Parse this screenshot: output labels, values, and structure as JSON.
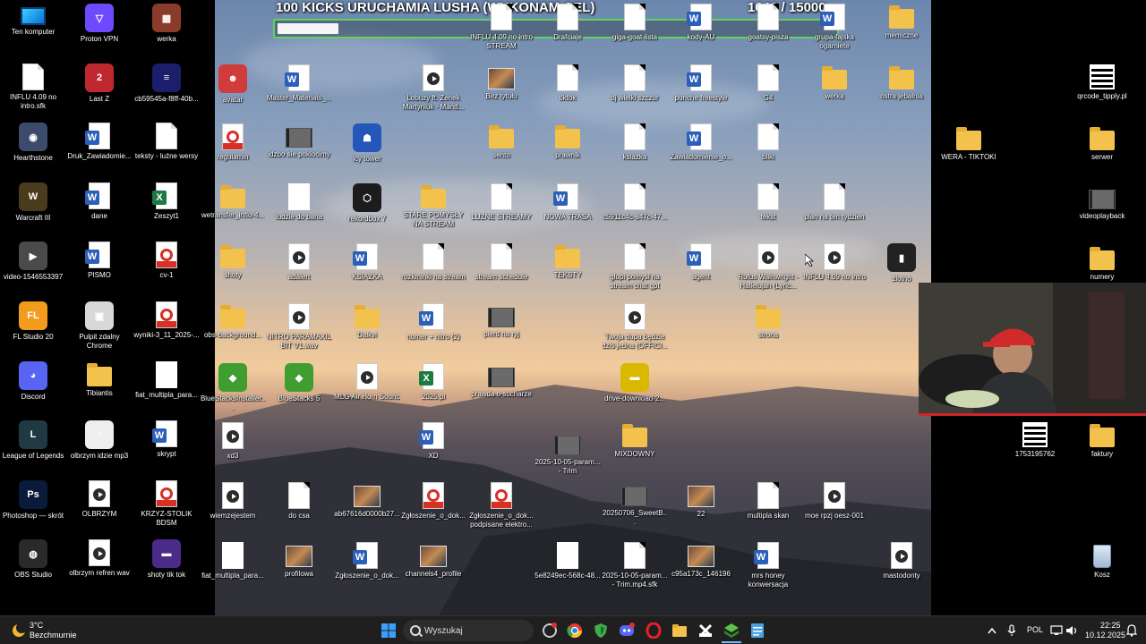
{
  "stream": {
    "title": "100 KICKS URUCHAMIA LUSHA (WYKONAM CEL)",
    "count": "1646",
    "goal": "/ 15000",
    "progress_fraction": 0.1097,
    "bar_color": "#5fd35f"
  },
  "desktop_left": [
    {
      "label": "Ten komputer",
      "type": "pc"
    },
    {
      "label": "Proton VPN",
      "type": "app",
      "color": "#6d4aff",
      "glyph": "▽"
    },
    {
      "label": "werka",
      "type": "app",
      "color": "#8b3b2a",
      "glyph": "▦"
    },
    {
      "label": "INFLU 4.09 no intro.sfk",
      "type": "doc"
    },
    {
      "label": "Last Z",
      "type": "app",
      "color": "#c0282f",
      "glyph": "2"
    },
    {
      "label": "cb59545a-f8ff-40b...",
      "type": "app",
      "color": "#1b1e6b",
      "glyph": "≡"
    },
    {
      "label": "Hearthstone",
      "type": "app",
      "color": "#3c4a6b",
      "glyph": "◉"
    },
    {
      "label": "Druk_Zawiadomie...",
      "type": "word"
    },
    {
      "label": "teksty - luźne wersy",
      "type": "doc"
    },
    {
      "label": "Warcraft III",
      "type": "app",
      "color": "#4a3b1f",
      "glyph": "W"
    },
    {
      "label": "dane",
      "type": "word"
    },
    {
      "label": "Zeszyt1",
      "type": "excel"
    },
    {
      "label": "video-1546553397",
      "type": "app",
      "color": "#4a4a4a",
      "glyph": "▶"
    },
    {
      "label": "PISMO",
      "type": "word"
    },
    {
      "label": "cv-1",
      "type": "pdf"
    },
    {
      "label": "FL Studio 20",
      "type": "app",
      "color": "#f29b1d",
      "glyph": "FL"
    },
    {
      "label": "Pulpit zdalny Chrome",
      "type": "app",
      "color": "#d8d8d8",
      "glyph": "▣"
    },
    {
      "label": "wyniki-3_11_2025-...",
      "type": "pdf"
    },
    {
      "label": "Discord",
      "type": "app",
      "color": "#5865f2",
      "glyph": "◕"
    },
    {
      "label": "Tibiantis",
      "type": "folder"
    },
    {
      "label": "fiat_multipla_para...",
      "type": "white"
    },
    {
      "label": "League of Legends",
      "type": "app",
      "color": "#1f3a43",
      "glyph": "L"
    },
    {
      "label": "olbrzym idzie mp3",
      "type": "app",
      "color": "#eeeeee",
      "glyph": "♪"
    },
    {
      "label": "skrypt",
      "type": "word"
    },
    {
      "label": "Photoshop — skrót",
      "type": "app",
      "color": "#0a1a3a",
      "glyph": "Ps"
    },
    {
      "label": "OLBRZYM",
      "type": "media"
    },
    {
      "label": "KRZYZ-STOLIK BDSM",
      "type": "pdf"
    },
    {
      "label": "OBS Studio",
      "type": "app",
      "color": "#2a2a2a",
      "glyph": "◍"
    },
    {
      "label": "olbrzym refren wav",
      "type": "media"
    },
    {
      "label": "shoty tik tok",
      "type": "app",
      "color": "#4b2b8a",
      "glyph": "▬"
    }
  ],
  "desktop_center": [
    {
      "label": "INFLU 4.09 no intro STREAM",
      "type": "doc"
    },
    {
      "label": "Drafciaje",
      "type": "doc"
    },
    {
      "label": "giga-goat-lista",
      "type": "doc"
    },
    {
      "label": "kody-AU",
      "type": "word"
    },
    {
      "label": "goatsy-pisza",
      "type": "doc"
    },
    {
      "label": "grupa-fajska ogarniete",
      "type": "word"
    },
    {
      "label": "memiczne",
      "type": "folder"
    },
    {
      "label": "avatar",
      "type": "app",
      "color": "#d23b3b",
      "glyph": "☻"
    },
    {
      "label": "Master_Materials_...",
      "type": "word"
    },
    {
      "label": "Lobuzy ft. Zenek Martyniuk - Mand...",
      "type": "media"
    },
    {
      "label": "Bez tytułu",
      "type": "image"
    },
    {
      "label": "tiktok",
      "type": "doc"
    },
    {
      "label": "dj wielki szczur",
      "type": "doc"
    },
    {
      "label": "punche freestyle",
      "type": "word"
    },
    {
      "label": "G4",
      "type": "doc"
    },
    {
      "label": "werka",
      "type": "folder"
    },
    {
      "label": "ostra jebalnia",
      "type": "folder"
    },
    {
      "label": "regulamin",
      "type": "pdf"
    },
    {
      "label": "idzbo sie poklocimy",
      "type": "video"
    },
    {
      "label": "icy tower",
      "type": "app",
      "color": "#2457b8",
      "glyph": "☗"
    },
    {
      "label": "sento",
      "type": "folder"
    },
    {
      "label": "prawnik",
      "type": "folder"
    },
    {
      "label": "ksiazka",
      "type": "doc"
    },
    {
      "label": "Zawiadomienie_o...",
      "type": "word"
    },
    {
      "label": "bilki",
      "type": "doc"
    },
    {
      "label": "wetransfer_influ-4...",
      "type": "folder"
    },
    {
      "label": "ludzie do bana",
      "type": "white"
    },
    {
      "label": "rekordbox 7",
      "type": "app",
      "color": "#1c1c1c",
      "glyph": "⬡"
    },
    {
      "label": "STARE POMYSŁY NA STREAM",
      "type": "folder"
    },
    {
      "label": "LUŹNE STREAMY",
      "type": "doc"
    },
    {
      "label": "NOWA TRASA",
      "type": "word"
    },
    {
      "label": "c5911c4c-a47c-47...",
      "type": "doc"
    },
    {
      "label": "tekst",
      "type": "doc"
    },
    {
      "label": "plan na ten tydzien",
      "type": "doc"
    },
    {
      "label": "shoty",
      "type": "folder"
    },
    {
      "label": "adalert",
      "type": "media"
    },
    {
      "label": "KSIAZKA",
      "type": "word"
    },
    {
      "label": "rozkminki na stream",
      "type": "doc"
    },
    {
      "label": "stream schedule",
      "type": "doc"
    },
    {
      "label": "TEKSTY",
      "type": "folder"
    },
    {
      "label": "glupi pomysl na stream chat gpt",
      "type": "doc"
    },
    {
      "label": "agent",
      "type": "word"
    },
    {
      "label": "Rufus Wainwright - Hallelujah (Lyric...",
      "type": "media"
    },
    {
      "label": "INFLU 4.09 no intro",
      "type": "media"
    },
    {
      "label": "zlotno",
      "type": "app",
      "color": "#222",
      "glyph": "▮"
    },
    {
      "label": "obs-background...",
      "type": "folder"
    },
    {
      "label": "NITRO PARAMAXIL BIT V1.wav",
      "type": "media"
    },
    {
      "label": "Dalkvi",
      "type": "folder"
    },
    {
      "label": "numer + nitro (2)",
      "type": "word"
    },
    {
      "label": "pierd na ryj",
      "type": "video"
    },
    {
      "label": "Twoja dupa będzie dziś jedna (OFFICI...",
      "type": "media"
    },
    {
      "label": "strona",
      "type": "folder"
    },
    {
      "label": "BlueStacksInstaller...",
      "type": "app",
      "color": "#3f9e2f",
      "glyph": "◆"
    },
    {
      "label": "BlueStacks 5",
      "type": "app",
      "color": "#3f9e2f",
      "glyph": "◆"
    },
    {
      "label": "MLG Air Horn Sound",
      "type": "media"
    },
    {
      "label": "2025.pl",
      "type": "excel"
    },
    {
      "label": "prawda o sucharze",
      "type": "video"
    },
    {
      "label": "drive-download-2...",
      "type": "app",
      "color": "#d9b800",
      "glyph": "▬"
    },
    {
      "label": "xd3",
      "type": "media"
    },
    {
      "label": "XD",
      "type": "word"
    },
    {
      "label": "2025-10-05-param... - Trim",
      "type": "video"
    },
    {
      "label": "MIXDOWNY",
      "type": "folder"
    },
    {
      "label": "wiemzejestem",
      "type": "media"
    },
    {
      "label": "do csa",
      "type": "doc"
    },
    {
      "label": "ab67616d0000b27...",
      "type": "image"
    },
    {
      "label": "Zgłoszenie_o_dok...",
      "type": "pdf"
    },
    {
      "label": "Zgłoszenie_o_dok... podpisane elektro...",
      "type": "pdf"
    },
    {
      "label": "20250706_SweetB...",
      "type": "video"
    },
    {
      "label": "22",
      "type": "image"
    },
    {
      "label": "multipla skan",
      "type": "doc"
    },
    {
      "label": "moe rpzj oesz-001",
      "type": "media"
    },
    {
      "label": "fiat_multipla_para...",
      "type": "white"
    },
    {
      "label": "profilowa",
      "type": "image"
    },
    {
      "label": "Zgłoszenie_o_dok...",
      "type": "word"
    },
    {
      "label": "channels4_profile",
      "type": "image"
    },
    {
      "label": "5e8249ec-568c-48...",
      "type": "white"
    },
    {
      "label": "2025-10-05-param... - Trim.mp4.sfk",
      "type": "doc"
    },
    {
      "label": "c95a173c_146196",
      "type": "image"
    },
    {
      "label": "mrs honey konwersacja",
      "type": "word"
    },
    {
      "label": "mastodonty",
      "type": "media"
    }
  ],
  "desktop_right": [
    {
      "label": "qrcode_tipply.pl",
      "type": "qr"
    },
    {
      "label": "WERA - TIKTOKI",
      "type": "folder"
    },
    {
      "label": "serwer",
      "type": "folder"
    },
    {
      "label": "videoplayback",
      "type": "video"
    },
    {
      "label": "numery",
      "type": "folder"
    },
    {
      "label": "1753195762",
      "type": "qr"
    },
    {
      "label": "faktury",
      "type": "folder"
    },
    {
      "label": "Kosz",
      "type": "bin"
    }
  ],
  "taskbar": {
    "weather_temp": "3°C",
    "weather_desc": "Bezchmurnie",
    "search_placeholder": "Wyszukaj",
    "language": "POL",
    "time": "22:25",
    "date": "10.12.2025"
  }
}
